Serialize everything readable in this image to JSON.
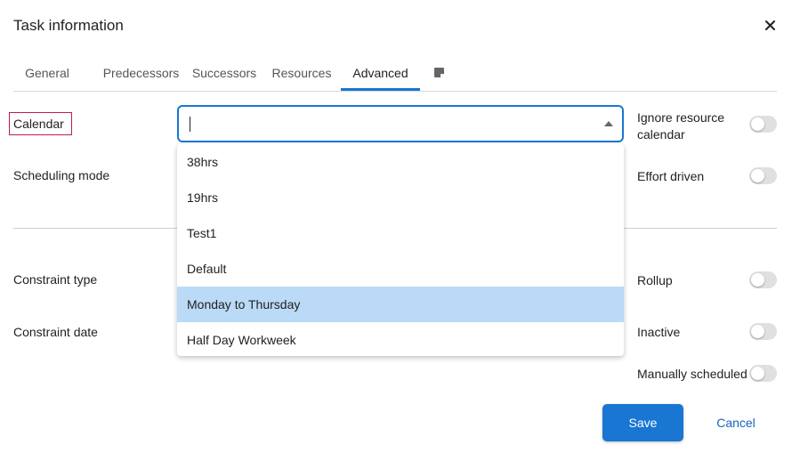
{
  "dialog": {
    "title": "Task information",
    "close_icon": "close-icon"
  },
  "tabs": [
    {
      "label": "General",
      "active": false
    },
    {
      "label": "Predecessors",
      "active": false
    },
    {
      "label": "Successors",
      "active": false
    },
    {
      "label": "Resources",
      "active": false
    },
    {
      "label": "Advanced",
      "active": true
    },
    {
      "icon": "sticky-note-icon",
      "active": false
    }
  ],
  "fields": {
    "calendar_label": "Calendar",
    "calendar_value": "",
    "scheduling_mode_label": "Scheduling mode",
    "constraint_type_label": "Constraint type",
    "constraint_date_label": "Constraint date"
  },
  "dropdown": {
    "options": [
      "38hrs",
      "19hrs",
      "Test1",
      "Default",
      "Monday to Thursday",
      "Half Day Workweek"
    ],
    "highlighted": "Monday to Thursday"
  },
  "toggles": {
    "ignore_resource_calendar_line1": "Ignore resource",
    "ignore_resource_calendar_line2": "calendar",
    "effort_driven": "Effort driven",
    "rollup": "Rollup",
    "inactive": "Inactive",
    "manually_scheduled": "Manually scheduled"
  },
  "colors": {
    "accent": "#1976d2",
    "highlight": "#bbdaf7",
    "calendar_label_border": "#c2185b"
  },
  "buttons": {
    "save": "Save",
    "cancel": "Cancel"
  }
}
